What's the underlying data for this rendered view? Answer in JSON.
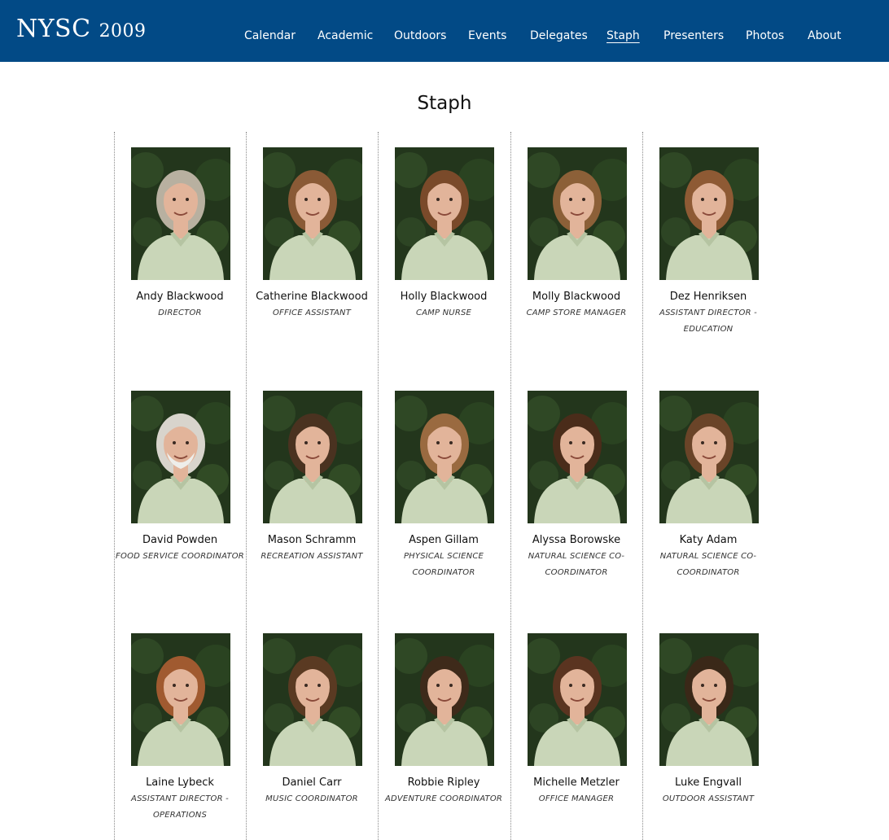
{
  "site": {
    "title": "NYSC",
    "year": "2009"
  },
  "nav": [
    {
      "label": "Calendar",
      "active": false
    },
    {
      "label": "Academic",
      "active": false
    },
    {
      "label": "Outdoors",
      "active": false
    },
    {
      "label": "Events",
      "active": false
    },
    {
      "label": "Delegates",
      "active": false
    },
    {
      "label": "Staph",
      "active": true
    },
    {
      "label": "Presenters",
      "active": false
    },
    {
      "label": "Photos",
      "active": false
    },
    {
      "label": "About",
      "active": false
    }
  ],
  "page": {
    "title": "Staph"
  },
  "colors": {
    "header_bg": "#024a86",
    "shirt": "#c9d6b8",
    "foliage": "#23361c"
  },
  "staff": [
    {
      "name": "Andy Blackwood",
      "role": "Director",
      "hair": "#b8b0a0",
      "beard": false
    },
    {
      "name": "Catherine Blackwood",
      "role": "Office Assistant",
      "hair": "#8a5a36",
      "beard": false
    },
    {
      "name": "Holly Blackwood",
      "role": "Camp Nurse",
      "hair": "#7a4a2a",
      "beard": false
    },
    {
      "name": "Molly Blackwood",
      "role": "Camp Store Manager",
      "hair": "#8c6038",
      "beard": false
    },
    {
      "name": "Dez Henriksen",
      "role": "Assistant Director - Education",
      "hair": "#8e5a34",
      "beard": false
    },
    {
      "name": "David Powden",
      "role": "Food Service Coordinator",
      "hair": "#d8d4cc",
      "beard": true
    },
    {
      "name": "Mason Schramm",
      "role": "Recreation Assistant",
      "hair": "#4a3220",
      "beard": false
    },
    {
      "name": "Aspen Gillam",
      "role": "Physical Science Coordinator",
      "hair": "#9a6a40",
      "beard": false
    },
    {
      "name": "Alyssa Borowske",
      "role": "Natural Science Co-Coordinator",
      "hair": "#4a2c1a",
      "beard": false
    },
    {
      "name": "Katy Adam",
      "role": "Natural Science Co-Coordinator",
      "hair": "#6a4428",
      "beard": false
    },
    {
      "name": "Laine Lybeck",
      "role": "Assistant Director - Operations",
      "hair": "#a05a30",
      "beard": false
    },
    {
      "name": "Daniel Carr",
      "role": "Music Coordinator",
      "hair": "#5a3a22",
      "beard": false
    },
    {
      "name": "Robbie Ripley",
      "role": "Adventure Coordinator",
      "hair": "#3e2a1a",
      "beard": false
    },
    {
      "name": "Michelle Metzler",
      "role": "Office Manager",
      "hair": "#5a3420",
      "beard": false
    },
    {
      "name": "Luke Engvall",
      "role": "Outdoor Assistant",
      "hair": "#3a2818",
      "beard": false
    }
  ]
}
